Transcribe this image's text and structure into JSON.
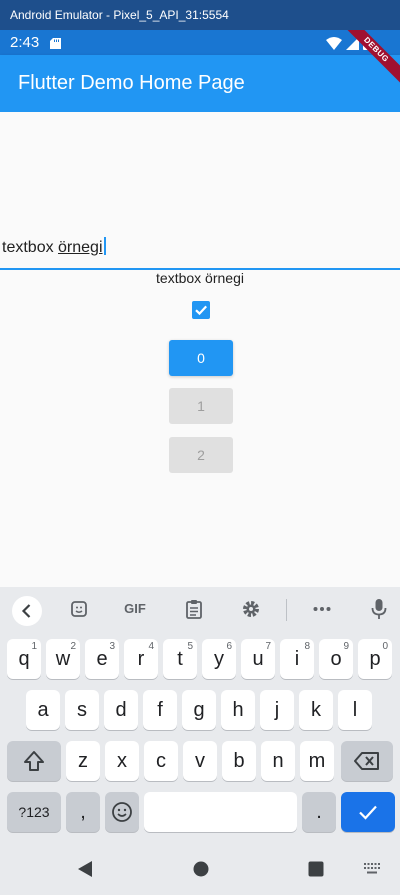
{
  "window": {
    "title": "Android Emulator - Pixel_5_API_31:5554"
  },
  "status_bar": {
    "time": "2:43"
  },
  "app_bar": {
    "title": "Flutter Demo Home Page",
    "debug_banner": "DEBUG"
  },
  "content": {
    "text_field": {
      "value_plain": "textbox ",
      "value_underlined": "örnegi"
    },
    "echo_text": "textbox örnegi",
    "checkbox_checked": true,
    "buttons": [
      {
        "label": "0",
        "enabled": true
      },
      {
        "label": "1",
        "enabled": false
      },
      {
        "label": "2",
        "enabled": false
      }
    ]
  },
  "keyboard": {
    "toolbar": {
      "gif_label": "GIF"
    },
    "row1": [
      {
        "key": "q",
        "hint": "1"
      },
      {
        "key": "w",
        "hint": "2"
      },
      {
        "key": "e",
        "hint": "3"
      },
      {
        "key": "r",
        "hint": "4"
      },
      {
        "key": "t",
        "hint": "5"
      },
      {
        "key": "y",
        "hint": "6"
      },
      {
        "key": "u",
        "hint": "7"
      },
      {
        "key": "i",
        "hint": "8"
      },
      {
        "key": "o",
        "hint": "9"
      },
      {
        "key": "p",
        "hint": "0"
      }
    ],
    "row2": [
      "a",
      "s",
      "d",
      "f",
      "g",
      "h",
      "j",
      "k",
      "l"
    ],
    "row3": [
      "z",
      "x",
      "c",
      "v",
      "b",
      "n",
      "m"
    ],
    "row4": {
      "symbols": "?123",
      "comma": ",",
      "period": "."
    }
  },
  "colors": {
    "primary": "#2196f3",
    "status_bar": "#1976d2",
    "keyboard_bg": "#e8eaed",
    "enter": "#1a73e8"
  }
}
